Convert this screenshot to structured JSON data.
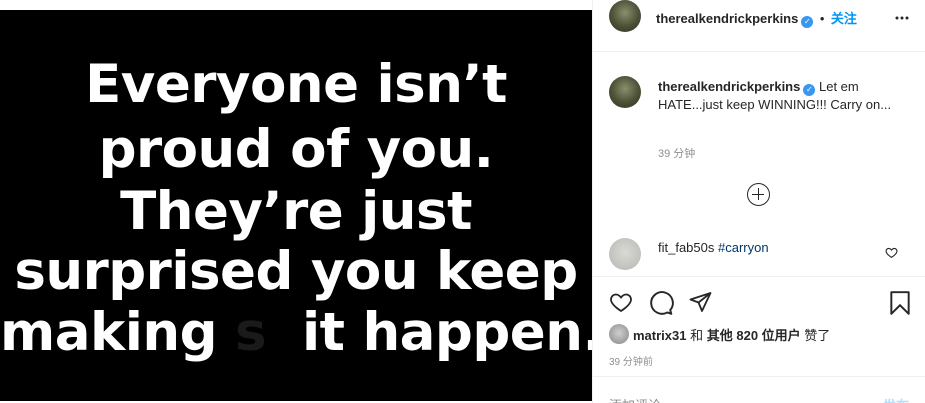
{
  "image_text": {
    "line1": "Everyone isn’t",
    "line2": "proud of you.",
    "line3": "They’re just",
    "line4": "surprised you keep",
    "line5_a": "making",
    "line5_censored": "s",
    "line5_b": "it happen."
  },
  "header": {
    "username": "therealkendrickperkins",
    "separator": "•",
    "follow_label": "关注",
    "more_icon": "more-horizontal-icon"
  },
  "caption": {
    "username": "therealkendrickperkins",
    "text": "Let em HATE...just keep WINNING!!! Carry on...",
    "time": "39 分钟"
  },
  "load_more_icon": "plus-circle-icon",
  "comment": {
    "username": "fit_fab50s",
    "hashtag": "#carryon"
  },
  "actions": {
    "icons": [
      "heart-icon",
      "comment-icon",
      "share-icon",
      "bookmark-icon"
    ],
    "likes_user": "matrix31",
    "likes_and": "和",
    "likes_others": "其他 820 位用户",
    "likes_suffix": "赞了",
    "time_ago": "39 分钟前"
  },
  "add_comment": {
    "placeholder": "添加评论...",
    "post_label": "发布"
  },
  "colors": {
    "accent": "#0095f6",
    "verified": "#3897f0",
    "muted": "#8e8e8e"
  }
}
